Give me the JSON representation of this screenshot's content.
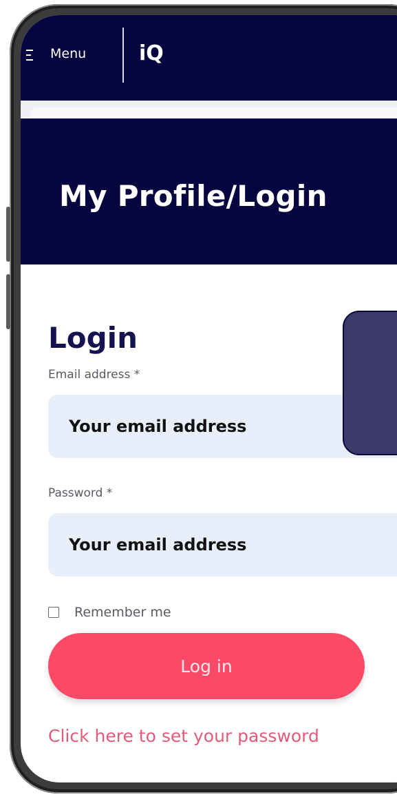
{
  "topbar": {
    "menu_label": "Menu",
    "logo_text": "iQ"
  },
  "hero": {
    "title": "My Profile/Login"
  },
  "login": {
    "heading": "Login",
    "email_label": "Email address *",
    "email_placeholder": "Your email address",
    "password_label": "Password *",
    "password_placeholder": "Your email address",
    "remember_label": "Remember me",
    "remember_checked": false,
    "submit_label": "Log in",
    "set_password_link": "Click here to set your password"
  },
  "colors": {
    "navy": "#07053f",
    "field_bg": "#e9effa",
    "button": "#fb4a67",
    "link": "#e45a79",
    "popover": "#3c3a6b"
  },
  "icons": {
    "menu": "hamburger-icon"
  }
}
